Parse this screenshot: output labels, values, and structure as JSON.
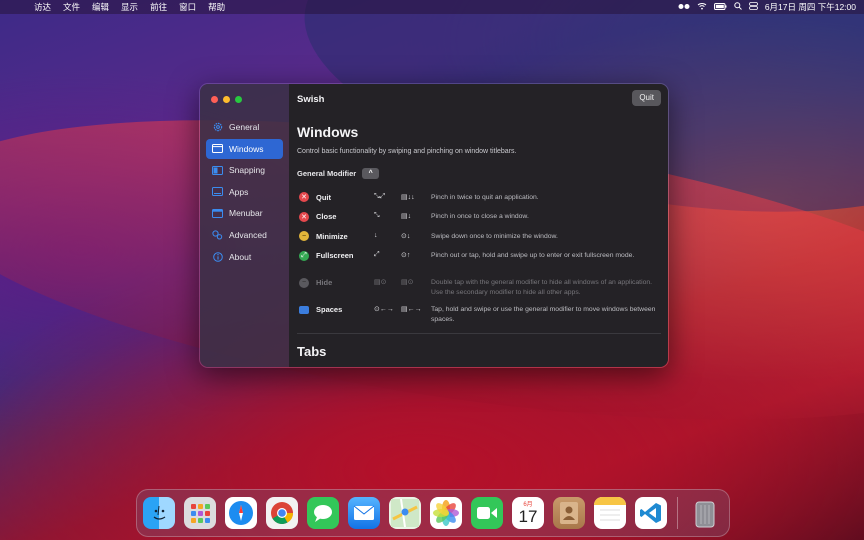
{
  "menubar": {
    "apple_glyph": "",
    "items": [
      "访达",
      "文件",
      "编辑",
      "显示",
      "前往",
      "窗口",
      "帮助"
    ],
    "clock": "6月17日 周四 下午12:00"
  },
  "window": {
    "title": "Swish",
    "quit_label": "Quit",
    "sidebar": [
      {
        "label": "General",
        "icon": "gear-icon"
      },
      {
        "label": "Windows",
        "icon": "window-icon"
      },
      {
        "label": "Snapping",
        "icon": "snapping-icon"
      },
      {
        "label": "Apps",
        "icon": "apps-icon"
      },
      {
        "label": "Menubar",
        "icon": "menubar-icon"
      },
      {
        "label": "Advanced",
        "icon": "advanced-icon"
      },
      {
        "label": "About",
        "icon": "info-icon"
      }
    ],
    "active_sidebar": "Windows",
    "heading": "Windows",
    "description": "Control basic functionality by swiping and pinching on window titlebars.",
    "modifier_label": "General Modifier",
    "modifier_symbol": "^",
    "gestures": [
      {
        "label": "Quit",
        "g1": "⤡⤢",
        "g2": "▤↓↓",
        "desc": "Pinch in twice to quit an application."
      },
      {
        "label": "Close",
        "g1": "⤡",
        "g2": "▤↓",
        "desc": "Pinch in once to close a window."
      },
      {
        "label": "Minimize",
        "g1": "↓",
        "g2": "⊙↓",
        "desc": "Swipe down once to minimize the window."
      },
      {
        "label": "Fullscreen",
        "g1": "⤢",
        "g2": "⊙↑",
        "desc": "Pinch out or tap, hold and swipe up to enter or exit fullscreen mode."
      },
      {
        "label": "Hide",
        "g1": "▤⊙",
        "g2": "▤⊙",
        "desc": "Double tap with the general modifier to hide all windows of an application. Use the secondary modifier to hide all other apps."
      },
      {
        "label": "Spaces",
        "g1": "⊙←→",
        "g2": "▤←→",
        "desc": "Tap, hold and swipe or use the general modifier to move windows between spaces."
      }
    ],
    "section2_heading": "Tabs"
  },
  "dock": {
    "apps": [
      "Finder",
      "Launchpad",
      "Safari",
      "Chrome",
      "Messages",
      "Mail",
      "Maps",
      "Photos",
      "FaceTime",
      "Calendar",
      "Contacts",
      "Notes",
      "Visual Studio Code",
      "Trash"
    ],
    "calendar_month": "6月",
    "calendar_day": "17"
  },
  "colors": {
    "accent": "#2e67d3",
    "quit_red": "#e5484d",
    "close_red": "#e5484d",
    "minimize_yellow": "#e2b53a",
    "fullscreen_green": "#34a853",
    "spaces_blue": "#3b7ddd"
  }
}
